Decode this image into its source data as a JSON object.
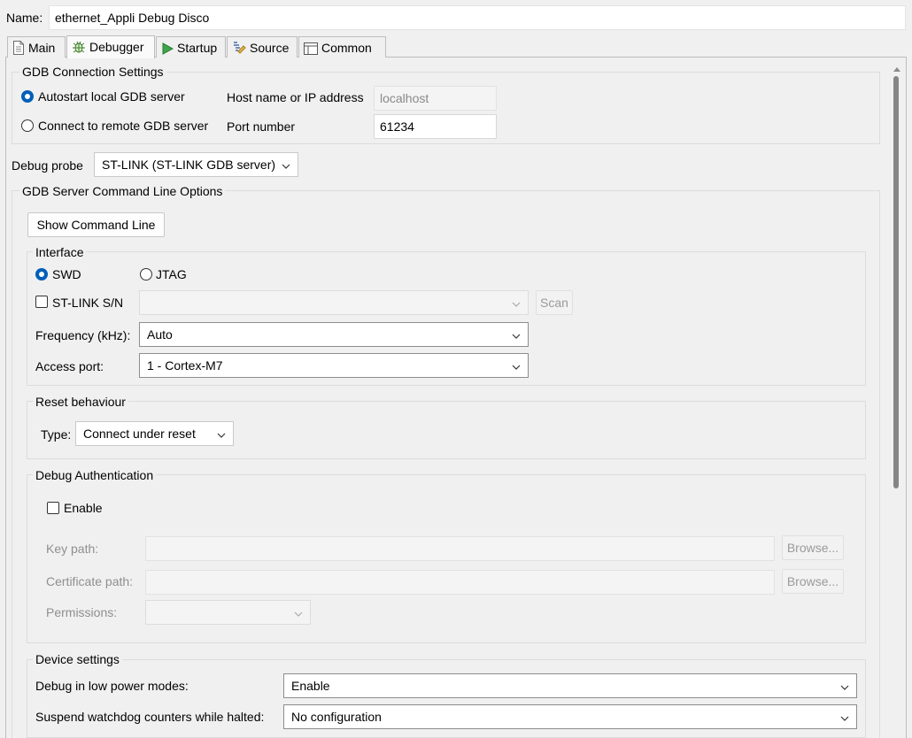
{
  "name_label": "Name:",
  "name_value": "ethernet_Appli Debug Disco",
  "tabs": [
    {
      "label": "Main",
      "icon": "document-icon"
    },
    {
      "label": "Debugger",
      "icon": "bug-icon"
    },
    {
      "label": "Startup",
      "icon": "play-icon"
    },
    {
      "label": "Source",
      "icon": "source-icon"
    },
    {
      "label": "Common",
      "icon": "table-icon"
    }
  ],
  "gdb_connection": {
    "title": "GDB Connection Settings",
    "autostart_label": "Autostart local GDB server",
    "autostart_selected": true,
    "remote_label": "Connect to remote GDB server",
    "host_label": "Host name or IP address",
    "host_value": "localhost",
    "port_label": "Port number",
    "port_value": "61234"
  },
  "debug_probe": {
    "label": "Debug probe",
    "value": "ST-LINK (ST-LINK GDB server)"
  },
  "gdb_server_options": {
    "title": "GDB Server Command Line Options",
    "show_command_line": "Show Command Line",
    "interface": {
      "title": "Interface",
      "swd_label": "SWD",
      "jtag_label": "JTAG",
      "stlink_sn_label": "ST-LINK S/N",
      "stlink_sn_value": "",
      "scan_label": "Scan",
      "frequency_label": "Frequency (kHz):",
      "frequency_value": "Auto",
      "access_port_label": "Access port:",
      "access_port_value": "1 - Cortex-M7"
    },
    "reset": {
      "title": "Reset behaviour",
      "type_label": "Type:",
      "type_value": "Connect under reset"
    },
    "debug_auth": {
      "title": "Debug Authentication",
      "enable_label": "Enable",
      "key_path_label": "Key path:",
      "cert_path_label": "Certificate path:",
      "permissions_label": "Permissions:",
      "browse_label": "Browse..."
    },
    "device_settings": {
      "title": "Device settings",
      "low_power_label": "Debug in low power modes:",
      "low_power_value": "Enable",
      "watchdog_label": "Suspend watchdog counters while halted:",
      "watchdog_value": "No configuration"
    }
  }
}
